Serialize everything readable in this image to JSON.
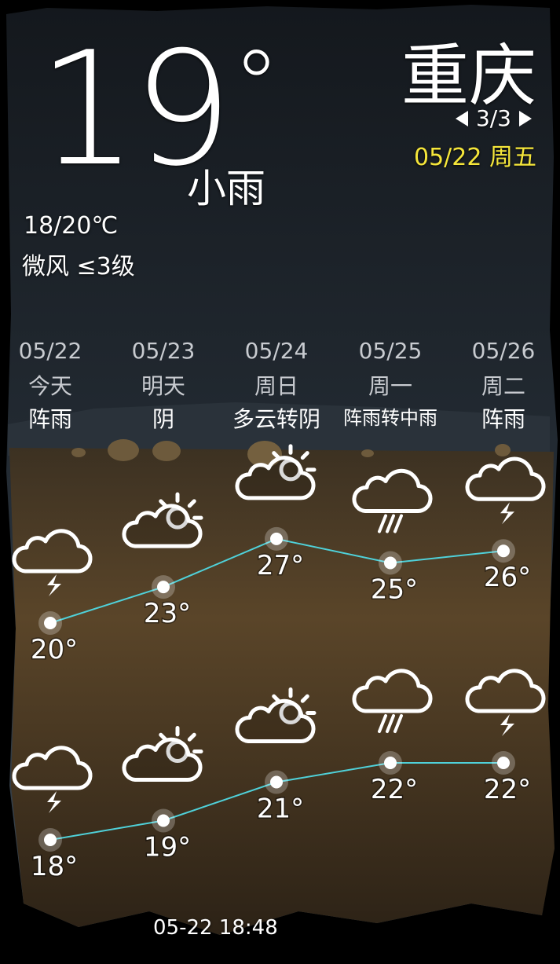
{
  "current": {
    "temperature": "19",
    "degree_symbol": "°",
    "condition": "小雨",
    "range": "18/20℃",
    "wind": "微风 ≤3级"
  },
  "city": "重庆",
  "pager": {
    "label": "3/3"
  },
  "today_date": "05/22 周五",
  "forecast": [
    {
      "date": "05/22",
      "weekday": "今天",
      "condition": "阵雨",
      "high": 20,
      "low": 18,
      "high_label": "20°",
      "low_label": "18°",
      "icon": "thunder-cloud-icon"
    },
    {
      "date": "05/23",
      "weekday": "明天",
      "condition": "阴",
      "high": 23,
      "low": 19,
      "high_label": "23°",
      "low_label": "19°",
      "icon": "partly-cloudy-icon"
    },
    {
      "date": "05/24",
      "weekday": "周日",
      "condition": "多云转阴",
      "high": 27,
      "low": 21,
      "high_label": "27°",
      "low_label": "21°",
      "icon": "partly-cloudy-icon"
    },
    {
      "date": "05/25",
      "weekday": "周一",
      "condition": "阵雨转中雨",
      "high": 25,
      "low": 22,
      "high_label": "25°",
      "low_label": "22°",
      "icon": "rain-cloud-icon"
    },
    {
      "date": "05/26",
      "weekday": "周二",
      "condition": "阵雨",
      "high": 26,
      "low": 22,
      "high_label": "26°",
      "low_label": "22°",
      "icon": "thunder-cloud-icon"
    }
  ],
  "updated": "05-22 18:48",
  "colors": {
    "line": "#4fd1d9",
    "date_accent": "#f5e63a"
  }
}
